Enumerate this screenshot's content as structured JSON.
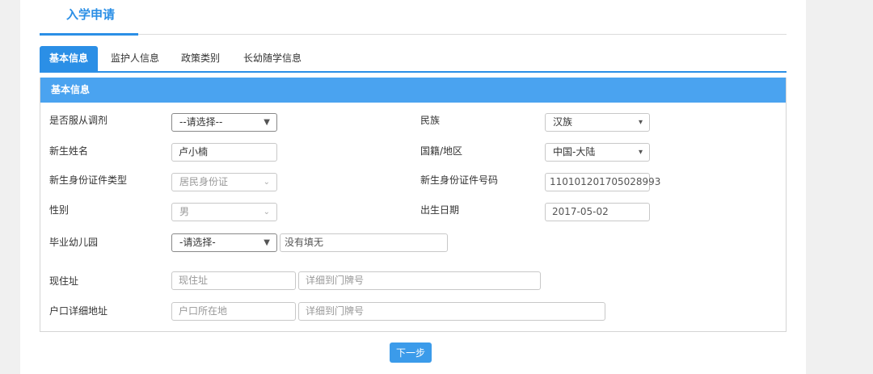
{
  "page_title": "入学申请",
  "tabs": [
    "基本信息",
    "监护人信息",
    "政策类别",
    "长幼随学信息"
  ],
  "section_title": "基本信息",
  "fields": {
    "obey_adjust": {
      "label": "是否服从调剂",
      "value": "--请选择--"
    },
    "ethnicity": {
      "label": "民族",
      "value": "汉族"
    },
    "name": {
      "label": "新生姓名",
      "value": "卢小楠"
    },
    "nationality": {
      "label": "国籍/地区",
      "value": "中国-大陆"
    },
    "id_type": {
      "label": "新生身份证件类型",
      "value": "居民身份证"
    },
    "id_number": {
      "label": "新生身份证件号码",
      "value": "110101201705028993"
    },
    "gender": {
      "label": "性别",
      "value": "男"
    },
    "birth_date": {
      "label": "出生日期",
      "value": "2017-05-02"
    },
    "kindergarten": {
      "label": "毕业幼儿园",
      "value": "-请选择-",
      "extra_value": "没有填无"
    },
    "current_address": {
      "label": "现住址",
      "placeholder_area": "现住址",
      "placeholder_detail": "详细到门牌号"
    },
    "hukou_address": {
      "label": "户口详细地址",
      "placeholder_area": "户口所在地",
      "placeholder_detail": "详细到门牌号"
    }
  },
  "next_button": "下一步",
  "colors": {
    "accent": "#2b8fe6",
    "header_bar": "#4aa3f0"
  }
}
